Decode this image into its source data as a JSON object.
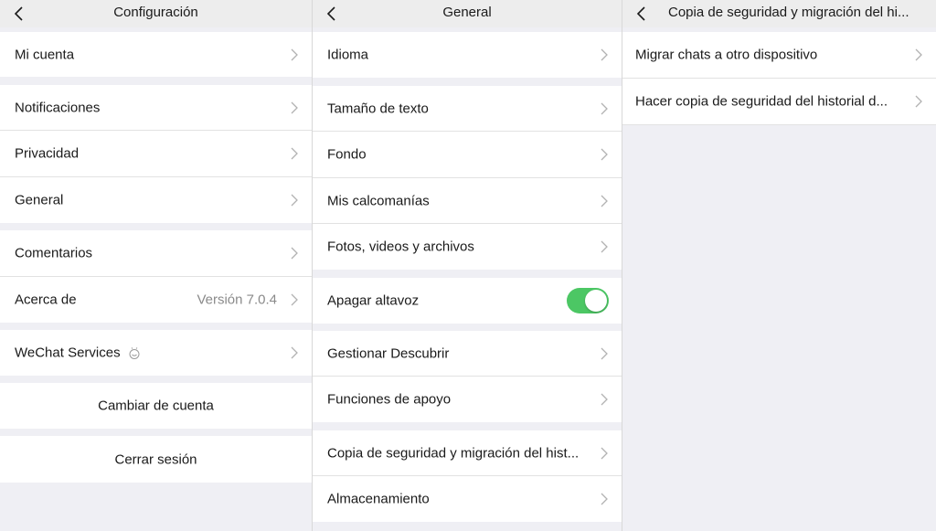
{
  "settings": {
    "title": "Configuración",
    "my_account": "Mi cuenta",
    "notifications": "Notificaciones",
    "privacy": "Privacidad",
    "general": "General",
    "feedback": "Comentarios",
    "about": "Acerca de",
    "version": "Versión 7.0.4",
    "wechat_services": "WeChat Services",
    "switch_account": "Cambiar de cuenta",
    "logout": "Cerrar sesión"
  },
  "general": {
    "title": "General",
    "language": "Idioma",
    "text_size": "Tamaño de texto",
    "background": "Fondo",
    "stickers": "Mis calcomanías",
    "media": "Fotos, videos y archivos",
    "speaker_off": "Apagar altavoz",
    "speaker_off_enabled": true,
    "manage_discover": "Gestionar Descubrir",
    "support_features": "Funciones de apoyo",
    "backup_migration": "Copia de seguridad y migración del hist...",
    "storage": "Almacenamiento"
  },
  "backup": {
    "title": "Copia de seguridad y migración del hi...",
    "migrate": "Migrar chats a otro dispositivo",
    "backup_history": "Hacer copia de seguridad del historial d..."
  },
  "colors": {
    "toggle_on": "#4cc764",
    "group_gap": "#efeff4",
    "navbar": "#ededed"
  }
}
